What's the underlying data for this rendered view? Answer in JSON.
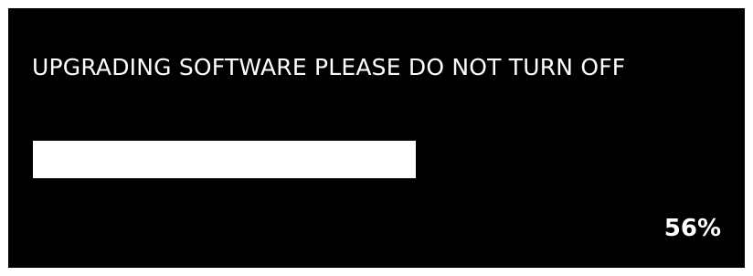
{
  "dialog": {
    "message": "UPGRADING SOFTWARE PLEASE DO NOT TURN OFF",
    "progress_percent": 56,
    "progress_label": "56%"
  },
  "colors": {
    "background": "#000000",
    "foreground": "#ffffff",
    "page_background": "#ffffff"
  }
}
